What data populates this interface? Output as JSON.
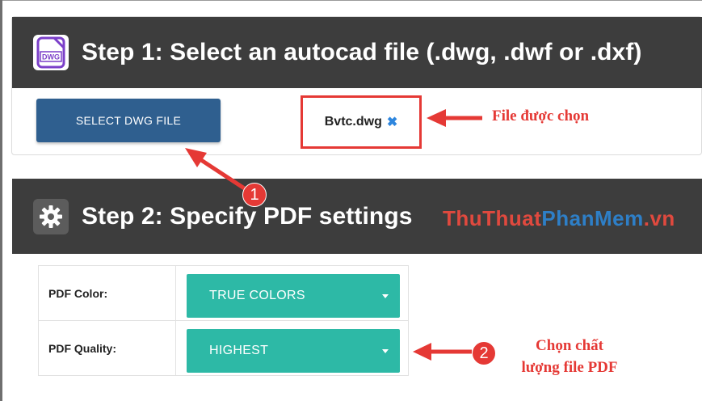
{
  "step1": {
    "title": "Step 1: Select an autocad file (.dwg, .dwf or .dxf)",
    "icon_text": "DWG"
  },
  "select_button": {
    "label": "SELECT DWG FILE"
  },
  "selected_file": {
    "name": "Bvtc.dwg",
    "remove_symbol": "✖"
  },
  "annotations": {
    "file_chosen": "File được chọn",
    "quality_line1": "Chọn chất",
    "quality_line2": "lượng file PDF",
    "badge1": "1",
    "badge2": "2"
  },
  "step2": {
    "title": "Step 2: Specify PDF settings"
  },
  "watermark": {
    "part1": "ThuThuat",
    "part2": "PhanMem",
    "part3": ".vn"
  },
  "settings": {
    "color_label": "PDF Color:",
    "color_value": "TRUE COLORS",
    "quality_label": "PDF Quality:",
    "quality_value": "HIGHEST"
  },
  "colors": {
    "header_bg": "#3d3d3d",
    "button_blue": "#2f5f8f",
    "dropdown_teal": "#2db9a6",
    "annotation_red": "#e53935"
  }
}
